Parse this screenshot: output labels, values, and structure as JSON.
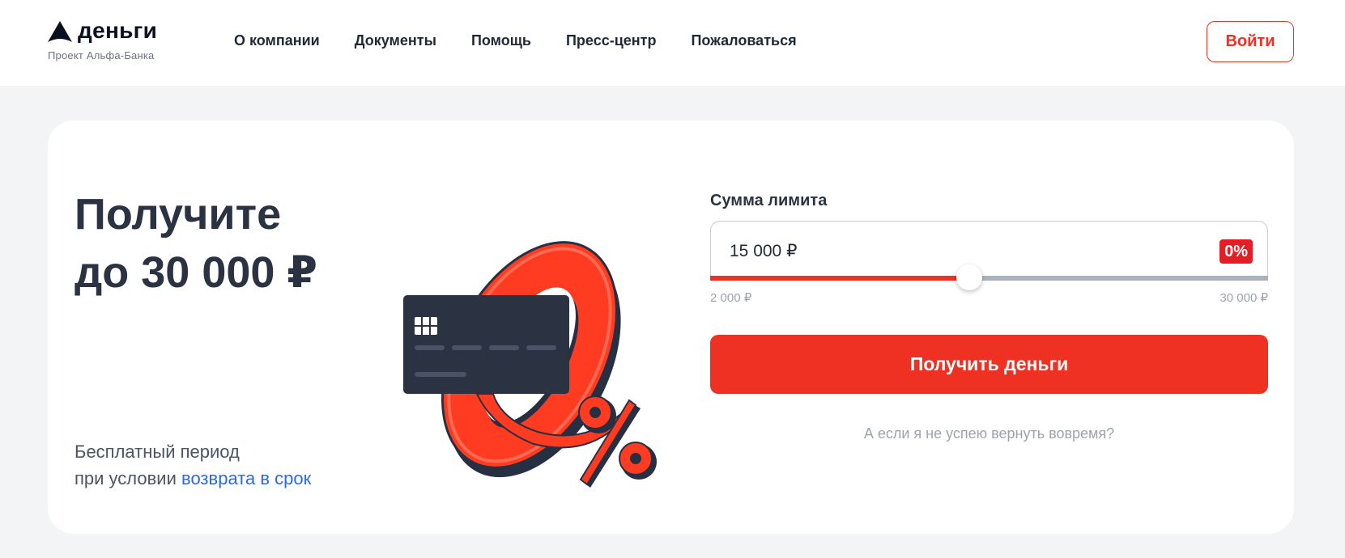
{
  "header": {
    "logo_text": "деньги",
    "logo_subtitle": "Проект Альфа-Банка",
    "nav": [
      {
        "label": "О компании"
      },
      {
        "label": "Документы"
      },
      {
        "label": "Помощь"
      },
      {
        "label": "Пресс-центр"
      },
      {
        "label": "Пожаловаться"
      }
    ],
    "login_label": "Войти"
  },
  "hero": {
    "title_line1": "Получите",
    "title_line2": "до 30 000 ₽",
    "subtitle_line1": "Бесплатный период",
    "subtitle_line2_prefix": "при условии ",
    "subtitle_link": "возврата в срок"
  },
  "calculator": {
    "label": "Сумма лимита",
    "amount": "15 000 ₽",
    "badge": "0%",
    "slider": {
      "min": 2000,
      "max": 30000,
      "value": 15000
    },
    "min_label": "2 000 ₽",
    "max_label": "30 000 ₽",
    "cta_label": "Получить деньги",
    "faq_link": "А если я не успею вернуть вовремя?"
  },
  "colors": {
    "accent": "#ef3124",
    "badge": "#e31e24",
    "link": "#2d6ae0",
    "dark": "#2b3242",
    "page_bg": "#f3f4f6"
  },
  "icons": [
    "alfa-logo-icon",
    "credit-card-illustration",
    "zero-percent-illustration"
  ]
}
